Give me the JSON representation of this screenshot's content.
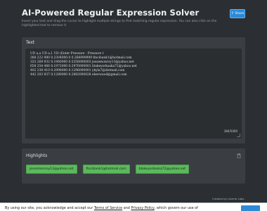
{
  "header": {
    "title": "AI-Powered Regular Expression Solver",
    "subtitle": "Insert your text and drag the cursor to highlight multiple strings to find matching regular expression. You can also click on the highlighted text to remove it.",
    "share_label": "Share"
  },
  "text_panel": {
    "label": "Text",
    "lines": [
      "UD a,a UD a,1 UD (Enter Pressure - Pressure t",
      "388 222 980 0.2304000.0 0.268999999 fincibank1@hotmail.com",
      "333 269 932 0.1960000 0.5358000003 jessemonroy13@yahoo.net",
      "658 254 466 0.1972000 0.2976000001 blakeyorkaska72@yahoo.net",
      "402 238 410 0.2998000 0.1296000001 ykyla7@dotmail.com",
      "442 203 837 0.1280000 0.2882000028 eberwuod@gmail.com"
    ],
    "char_count": "384/5000"
  },
  "highlights": {
    "label": "Highlights",
    "chips": [
      "jessemonroy13@yahoo.net",
      "fincibank1@hotmail.com",
      "blakeyorkaska72@yahoo.net"
    ]
  },
  "footer": {
    "credit": "Created by Liberte Labs"
  },
  "cookie": {
    "prefix": "By using our site, you acknowledge and accept our ",
    "terms": "Terms of Service",
    "and": " and ",
    "privacy": "Privacy Policy",
    "suffix": ", which govern our use of"
  },
  "colors": {
    "background": "#2b2f33",
    "panel": "#3a3e42",
    "accent": "#2d8ad6",
    "highlight": "#5cb85c"
  }
}
